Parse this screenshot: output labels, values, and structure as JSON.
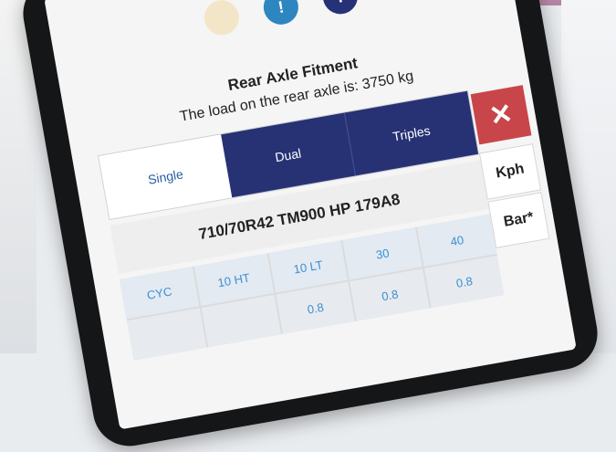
{
  "header": {
    "icons": [
      "light-icon",
      "info-icon",
      "help-icon"
    ],
    "info_glyph": "!",
    "help_glyph": "?"
  },
  "fitment": {
    "title": "Rear Axle Fitment",
    "subtitle": "The load on the rear axle is: 3750 kg"
  },
  "axle_tabs": {
    "single": "Single",
    "dual": "Dual",
    "triples": "Triples"
  },
  "close": {
    "glyph": "✕"
  },
  "tyre": {
    "spec": "710/70R42 TM900 HP 179A8"
  },
  "units": {
    "speed": "Kph",
    "pressure": "Bar*"
  },
  "grid": {
    "rows": [
      [
        "CYC",
        "10 HT",
        "10 LT",
        "30",
        "40"
      ],
      [
        "",
        "",
        "0.8",
        "0.8",
        "0.8"
      ]
    ]
  },
  "colors": {
    "accent": "#273275",
    "info": "#2e86c1",
    "danger": "#c8464a",
    "link": "#2a5fa8",
    "cell_text": "#3d8fd0"
  }
}
